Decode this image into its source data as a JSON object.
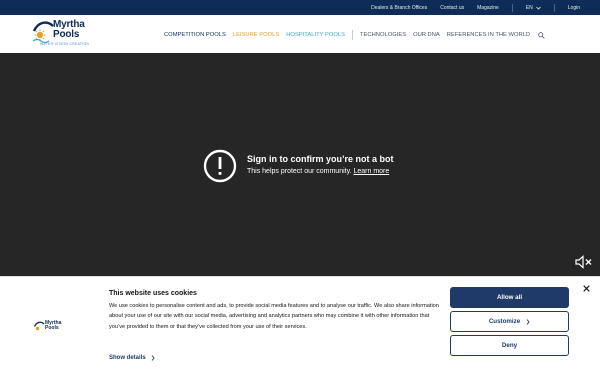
{
  "topbar": {
    "links": [
      "Dealers & Branch Offices",
      "Contact us",
      "Magazine"
    ],
    "language": "EN",
    "login": "Login"
  },
  "brand": {
    "line1": "Myrtha",
    "line2": "Pools",
    "tagline": "WATER·VISION·CREATION"
  },
  "nav": {
    "competition": "COMPETITION POOLS",
    "leisure": "LEISURE POOLS",
    "hospitality": "HOSPITALITY POOLS",
    "technologies": "TECHNOLOGIES",
    "dna": "OUR DNA",
    "references": "REFERENCES IN THE WORLD"
  },
  "video": {
    "title": "Sign in to confirm you’re not a bot",
    "subtitle": "This helps protect our community.",
    "learn_more": "Learn more"
  },
  "cookie": {
    "title": "This website uses cookies",
    "body": "We use cookies to personalise content and ads, to provide social media features and to analyse our traffic. We also share information about your use of our site with our social media, advertising and analytics partners who may combine it with other information that you’ve provided to them or that they’ve collected from your use of their services.",
    "show_details": "Show details",
    "allow_all": "Allow all",
    "customize": "Customize",
    "deny": "Deny"
  },
  "colors": {
    "navy": "#0e2c57",
    "button": "#1f3a68",
    "leisure": "#e4a12b",
    "hospitality": "#3fa8c6"
  },
  "icons": [
    "sun-logo-icon",
    "chevron-down-icon",
    "search-icon",
    "alert-icon",
    "mute-icon",
    "chevron-right-icon",
    "close-icon"
  ]
}
